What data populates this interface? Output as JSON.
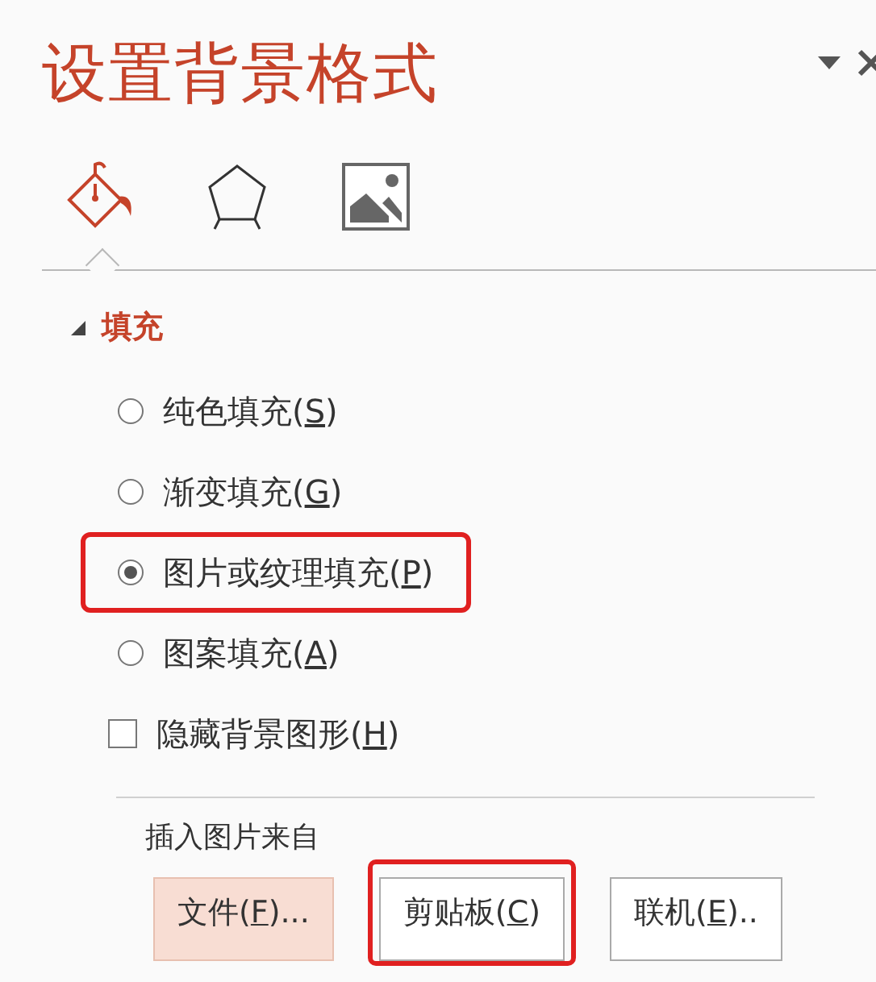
{
  "pane": {
    "title": "设置背景格式"
  },
  "tabs": [
    {
      "kind": "fill",
      "selected": true
    },
    {
      "kind": "effects",
      "selected": false
    },
    {
      "kind": "picture",
      "selected": false
    }
  ],
  "section": {
    "title": "填充",
    "expanded": true
  },
  "fill_options": [
    {
      "kind": "radio",
      "text_before": "纯色填充(",
      "access_key": "S",
      "text_after": ")",
      "selected": false,
      "highlighted": false
    },
    {
      "kind": "radio",
      "text_before": "渐变填充(",
      "access_key": "G",
      "text_after": ")",
      "selected": false,
      "highlighted": false
    },
    {
      "kind": "radio",
      "text_before": "图片或纹理填充(",
      "access_key": "P",
      "text_after": ")",
      "selected": true,
      "highlighted": true
    },
    {
      "kind": "radio",
      "text_before": "图案填充(",
      "access_key": "A",
      "text_after": ")",
      "selected": false,
      "highlighted": false
    },
    {
      "kind": "checkbox",
      "text_before": "隐藏背景图形(",
      "access_key": "H",
      "text_after": ")",
      "checked": false,
      "highlighted": false
    }
  ],
  "insert_from": {
    "label": "插入图片来自",
    "buttons": [
      {
        "text_before": "文件(",
        "access_key": "F",
        "text_after": ")...",
        "hovered": true,
        "highlighted": false
      },
      {
        "text_before": "剪贴板(",
        "access_key": "C",
        "text_after": ")",
        "hovered": false,
        "highlighted": true
      },
      {
        "text_before": "联机(",
        "access_key": "E",
        "text_after": ")..",
        "hovered": false,
        "highlighted": false
      }
    ]
  }
}
